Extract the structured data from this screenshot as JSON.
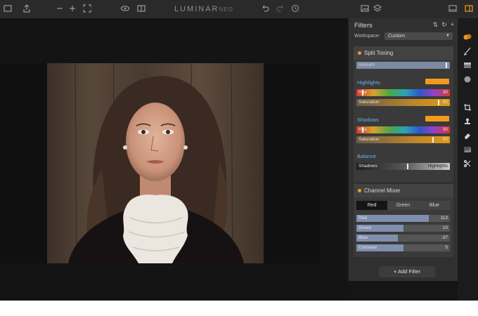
{
  "app": {
    "logo": "LUMINAR",
    "logo_suffix": "NEO"
  },
  "panel": {
    "title": "Filters",
    "workspace_label": "Workspace:",
    "workspace_value": "Custom",
    "split_toning": {
      "title": "Split Toning",
      "amount_label": "Amount",
      "highlights": {
        "label": "Highlights",
        "hue_label": "Hue",
        "hue_value": "30",
        "sat_label": "Saturation",
        "sat_value": "50"
      },
      "shadows": {
        "label": "Shadows",
        "hue_label": "Hue",
        "hue_value": "30",
        "sat_label": "Saturation",
        "sat_value": "50"
      },
      "balance": {
        "label": "Balance",
        "left": "Shadows",
        "right": "Highlights"
      }
    },
    "channel_mixer": {
      "title": "Channel Mixer",
      "tabs": [
        "Red",
        "Green",
        "Blue"
      ],
      "rows": [
        {
          "label": "Red",
          "value": "113"
        },
        {
          "label": "Green",
          "value": "10"
        },
        {
          "label": "Blue",
          "value": "-37"
        },
        {
          "label": "Constant",
          "value": "5"
        }
      ]
    },
    "add_filter": "Add Filter"
  },
  "colors": {
    "accent": "#f29a1e",
    "section": "#6fb0e6"
  }
}
